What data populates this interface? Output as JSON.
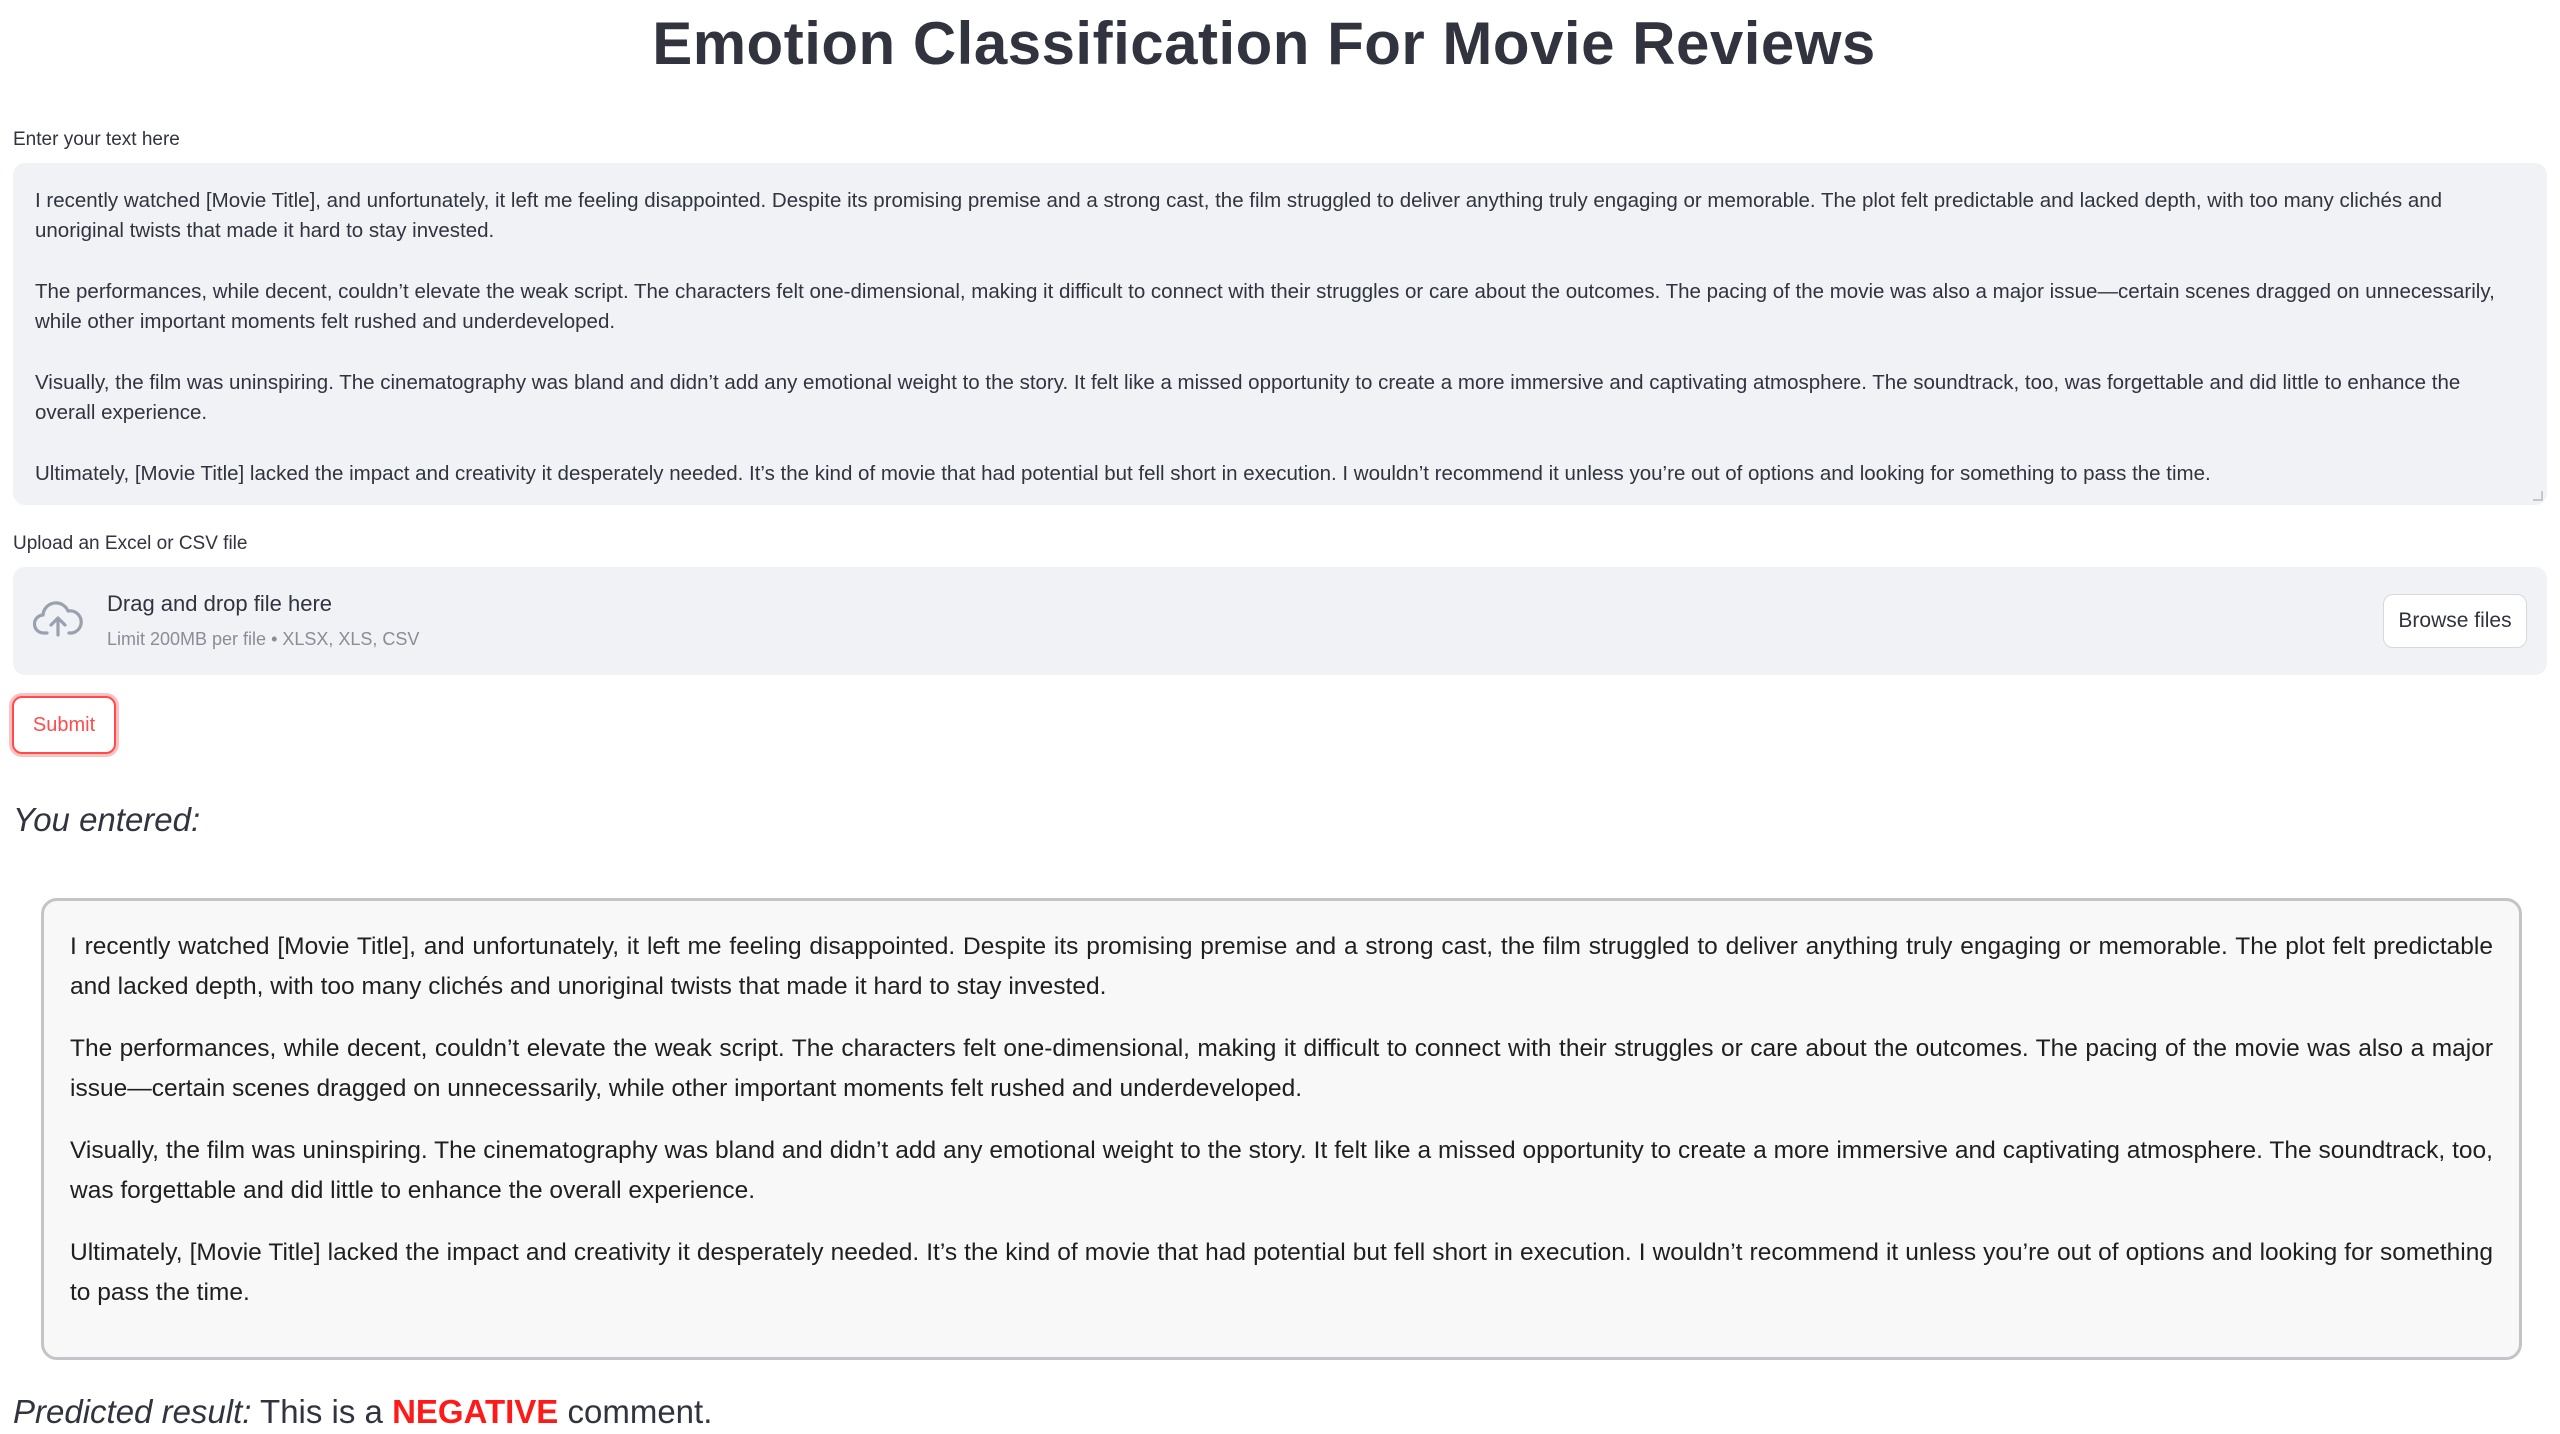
{
  "page": {
    "title": "Emotion Classification For Movie Reviews"
  },
  "text_input": {
    "label": "Enter your text here",
    "paragraphs": [
      "I recently watched [Movie Title], and unfortunately, it left me feeling disappointed. Despite its promising premise and a strong cast, the film struggled to deliver anything truly engaging or memorable. The plot felt predictable and lacked depth, with too many clichés and unoriginal twists that made it hard to stay invested.",
      "The performances, while decent, couldn’t elevate the weak script. The characters felt one-dimensional, making it difficult to connect with their struggles or care about the outcomes. The pacing of the movie was also a major issue—certain scenes dragged on unnecessarily, while other important moments felt rushed and underdeveloped.",
      "Visually, the film was uninspiring. The cinematography was bland and didn’t add any emotional weight to the story. It felt like a missed opportunity to create a more immersive and captivating atmosphere. The soundtrack, too, was forgettable and did little to enhance the overall experience.",
      "Ultimately, [Movie Title] lacked the impact and creativity it desperately needed. It’s the kind of movie that had potential but fell short in execution. I wouldn’t recommend it unless you’re out of options and looking for something to pass the time."
    ]
  },
  "file_upload": {
    "label": "Upload an Excel or CSV file",
    "drop_text": "Drag and drop file here",
    "limit_text": "Limit 200MB per file • XLSX, XLS, CSV",
    "browse_label": "Browse files",
    "icon": "cloud-upload-icon"
  },
  "submit": {
    "label": "Submit"
  },
  "entered": {
    "heading": "You entered:",
    "paragraphs": [
      "I recently watched [Movie Title], and unfortunately, it left me feeling disappointed. Despite its promising premise and a strong cast, the film struggled to deliver anything truly engaging or memorable. The plot felt predictable and lacked depth, with too many clichés and unoriginal twists that made it hard to stay invested.",
      "The performances, while decent, couldn’t elevate the weak script. The characters felt one-dimensional, making it difficult to connect with their struggles or care about the outcomes. The pacing of the movie was also a major issue—certain scenes dragged on unnecessarily, while other important moments felt rushed and underdeveloped.",
      "Visually, the film was uninspiring. The cinematography was bland and didn’t add any emotional weight to the story. It felt like a missed opportunity to create a more immersive and captivating atmosphere. The soundtrack, too, was forgettable and did little to enhance the overall experience.",
      "Ultimately, [Movie Title] lacked the impact and creativity it desperately needed. It’s the kind of movie that had potential but fell short in execution. I wouldn’t recommend it unless you’re out of options and looking for something to pass the time."
    ]
  },
  "prediction": {
    "label": "Predicted result:",
    "prefix": "This is a",
    "value": "NEGATIVE",
    "suffix": "comment."
  },
  "colors": {
    "accent": "#ff4b4b",
    "negative": "#ff1a1a",
    "text": "#31333f",
    "input_bg": "#f0f2f6"
  }
}
